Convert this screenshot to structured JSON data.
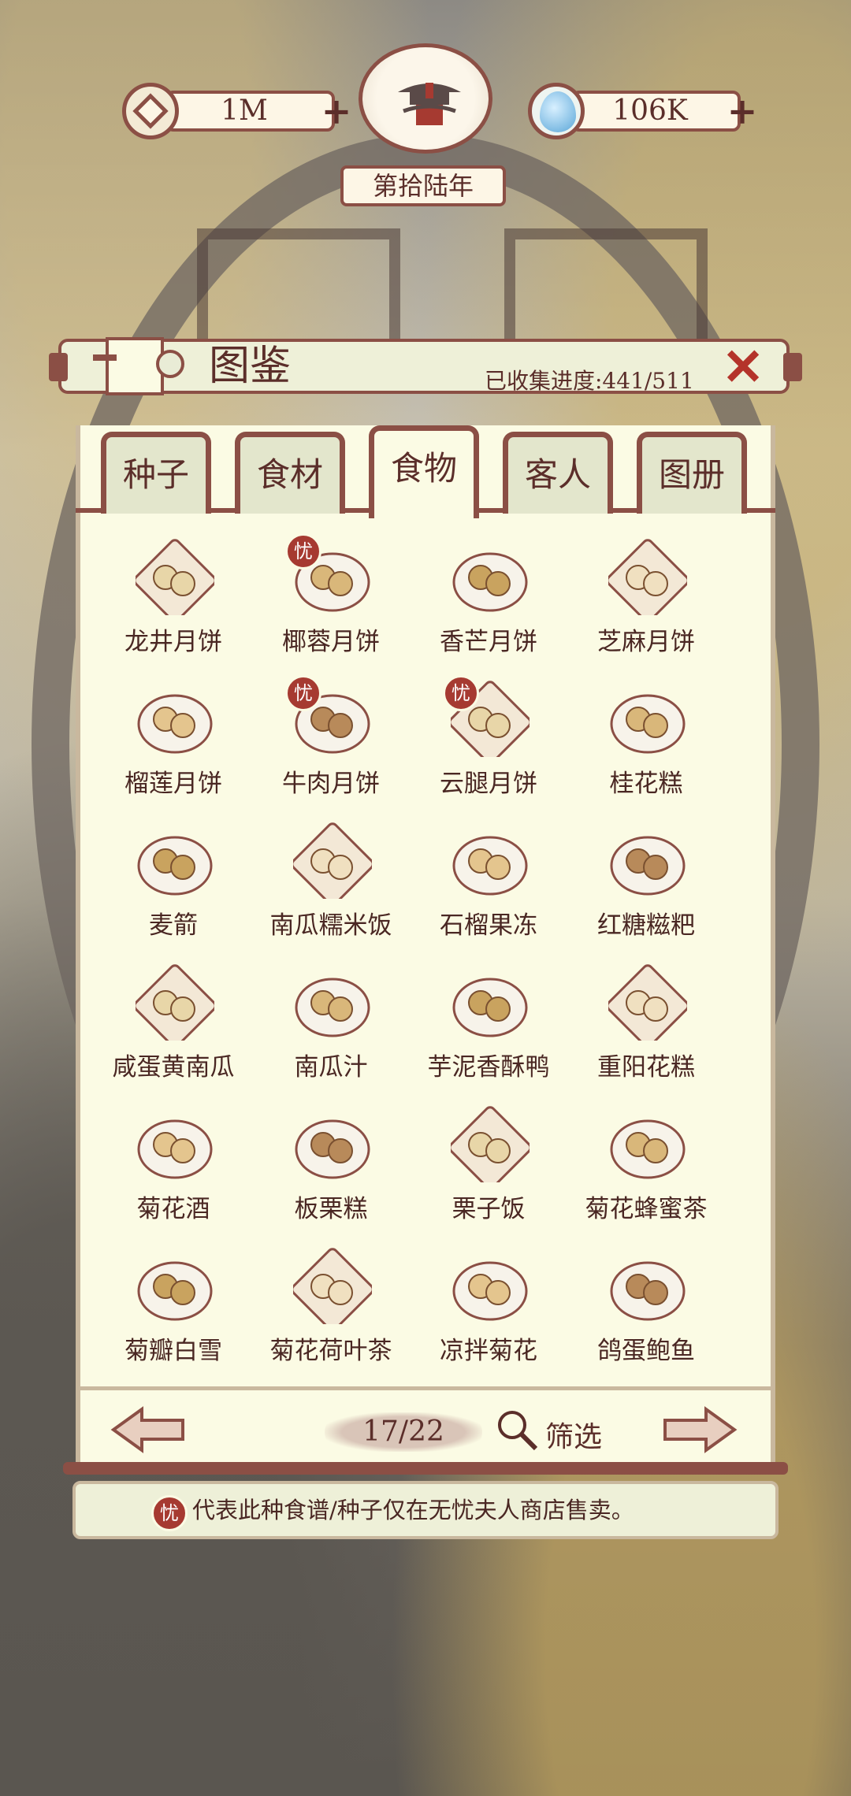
{
  "top": {
    "coins": "1M",
    "jade": "106K",
    "year": "第拾陆年"
  },
  "panel": {
    "title": "图鉴",
    "progress": "已收集进度:441/511",
    "close": "✕"
  },
  "tabs": [
    {
      "label": "种子",
      "active": false
    },
    {
      "label": "食材",
      "active": false
    },
    {
      "label": "食物",
      "active": true
    },
    {
      "label": "客人",
      "active": false
    },
    {
      "label": "图册",
      "active": false
    }
  ],
  "items": [
    {
      "name": "龙井月饼",
      "badge": false
    },
    {
      "name": "椰蓉月饼",
      "badge": true
    },
    {
      "name": "香芒月饼",
      "badge": false
    },
    {
      "name": "芝麻月饼",
      "badge": false
    },
    {
      "name": "榴莲月饼",
      "badge": false
    },
    {
      "name": "牛肉月饼",
      "badge": true
    },
    {
      "name": "云腿月饼",
      "badge": true
    },
    {
      "name": "桂花糕",
      "badge": false
    },
    {
      "name": "麦箭",
      "badge": false
    },
    {
      "name": "南瓜糯米饭",
      "badge": false
    },
    {
      "name": "石榴果冻",
      "badge": false
    },
    {
      "name": "红糖糍粑",
      "badge": false
    },
    {
      "name": "咸蛋黄南瓜",
      "badge": false
    },
    {
      "name": "南瓜汁",
      "badge": false
    },
    {
      "name": "芋泥香酥鸭",
      "badge": false
    },
    {
      "name": "重阳花糕",
      "badge": false
    },
    {
      "name": "菊花酒",
      "badge": false
    },
    {
      "name": "板栗糕",
      "badge": false
    },
    {
      "name": "栗子饭",
      "badge": false
    },
    {
      "name": "菊花蜂蜜茶",
      "badge": false
    },
    {
      "name": "菊瓣白雪",
      "badge": false
    },
    {
      "name": "菊花荷叶茶",
      "badge": false
    },
    {
      "name": "凉拌菊花",
      "badge": false
    },
    {
      "name": "鸽蛋鲍鱼",
      "badge": false
    }
  ],
  "badge_char": "忧",
  "pager": {
    "page": "17/22",
    "filter": "筛选"
  },
  "note": "代表此种食谱/种子仅在无忧夫人商店售卖。",
  "colors": {
    "frame": "#8b4f45",
    "panel": "#fbfbe4",
    "badge": "#a63a31"
  }
}
